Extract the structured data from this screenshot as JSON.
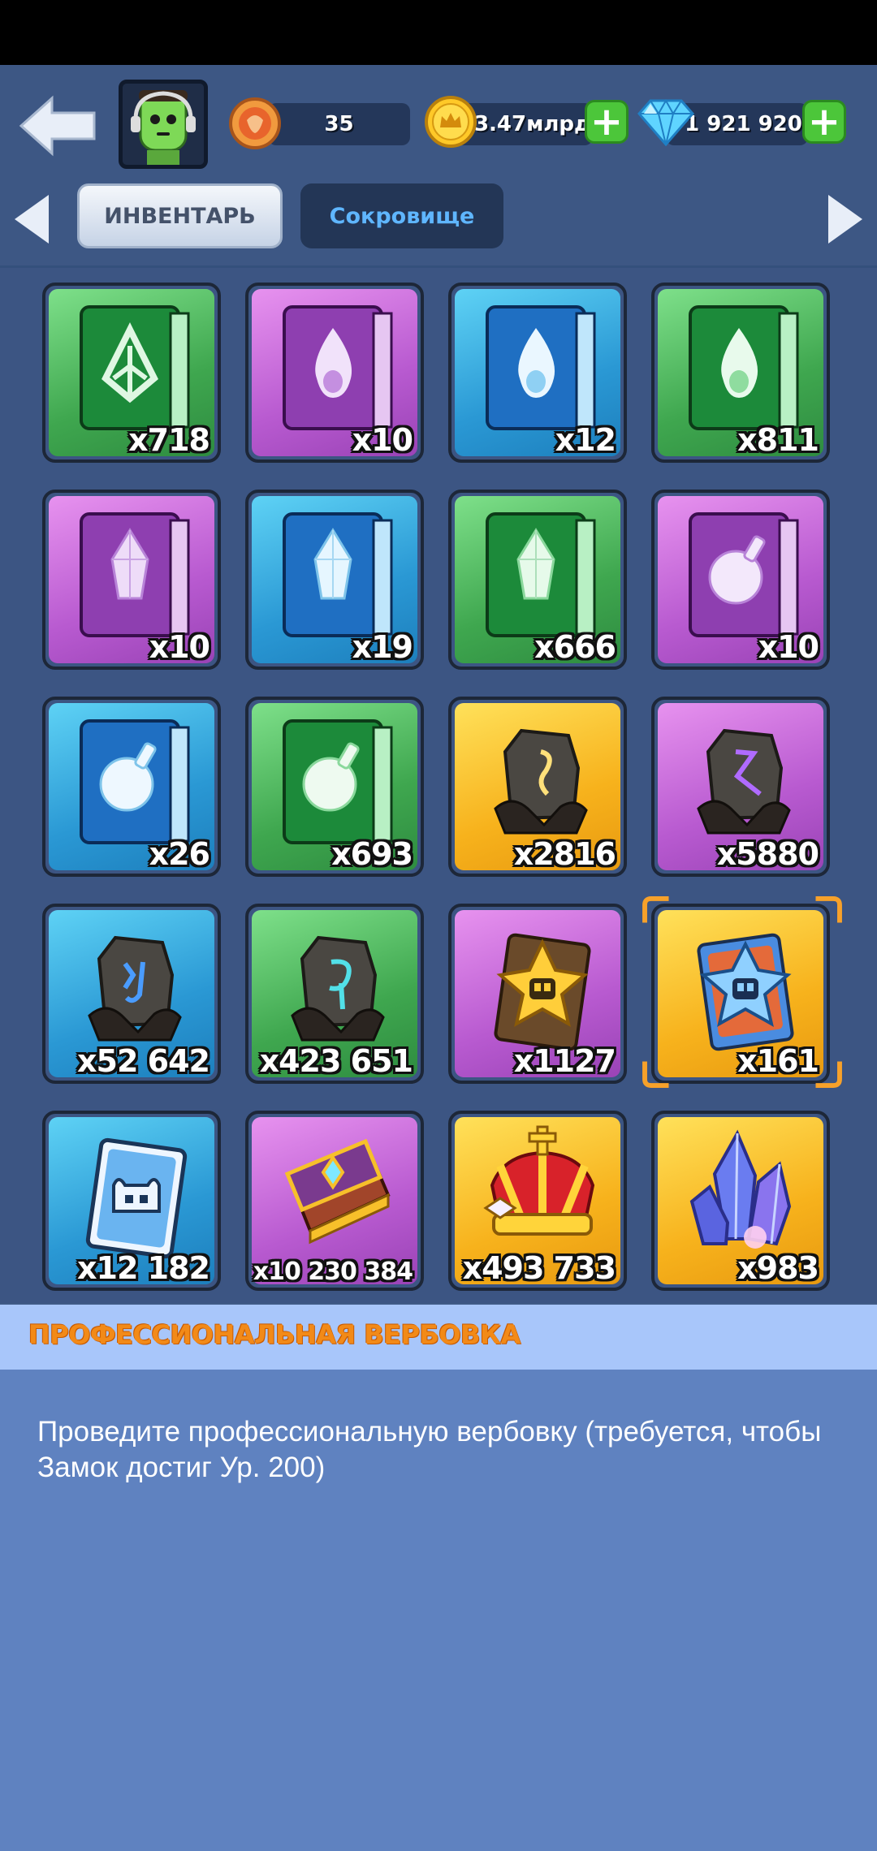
{
  "header": {
    "level": "35",
    "gold": "3.47млрд",
    "gems": "1 921 920"
  },
  "tabs": [
    {
      "label": "ИНВЕНТАРЬ",
      "active": true
    },
    {
      "label": "Сокровище",
      "active": false
    }
  ],
  "items": [
    {
      "count": "x718",
      "color": "green",
      "icon": "leaf-tome-icon"
    },
    {
      "count": "x10",
      "color": "purple",
      "icon": "flame-tome-icon"
    },
    {
      "count": "x12",
      "color": "blue",
      "icon": "flame-tome-icon"
    },
    {
      "count": "x811",
      "color": "green",
      "icon": "flame-tome-icon"
    },
    {
      "count": "x10",
      "color": "purple",
      "icon": "crystal-tome-icon"
    },
    {
      "count": "x19",
      "color": "blue",
      "icon": "crystal-tome-icon"
    },
    {
      "count": "x666",
      "color": "green",
      "icon": "crystal-tome-icon"
    },
    {
      "count": "x10",
      "color": "purple",
      "icon": "potion-tome-icon"
    },
    {
      "count": "x26",
      "color": "blue",
      "icon": "potion-tome-icon"
    },
    {
      "count": "x693",
      "color": "green",
      "icon": "potion-tome-icon"
    },
    {
      "count": "x2816",
      "color": "gold",
      "icon": "rune-stone-icon"
    },
    {
      "count": "x5880",
      "color": "purple",
      "icon": "rune-stone-icon"
    },
    {
      "count": "x52 642",
      "color": "blue",
      "icon": "rune-stone-icon"
    },
    {
      "count": "x423 651",
      "color": "green",
      "icon": "rune-stone-icon"
    },
    {
      "count": "x1127",
      "color": "purple",
      "icon": "gold-crest-card-icon"
    },
    {
      "count": "x161",
      "color": "gold",
      "icon": "blue-crest-card-icon"
    },
    {
      "count": "x12 182",
      "color": "blue",
      "icon": "recruit-card-icon"
    },
    {
      "count": "x10 230 384",
      "color": "purple",
      "icon": "golden-book-icon"
    },
    {
      "count": "x493 733",
      "color": "gold",
      "icon": "crown-icon"
    },
    {
      "count": "x983",
      "color": "gold",
      "icon": "crystal-cluster-icon"
    }
  ],
  "selected_index": 15,
  "details": {
    "title": "ПРОФЕССИОНАЛЬНАЯ ВЕРБОВКА",
    "description": "Проведите профессиональную вербовку (требуется, чтобы Замок достиг Ур. 200)"
  },
  "colors": {
    "background": "#3f5a86",
    "title": "#f28a18",
    "details_bg": "#5f82c0",
    "header_bar": "#a8c6fa",
    "plus": "#4cc63a"
  }
}
